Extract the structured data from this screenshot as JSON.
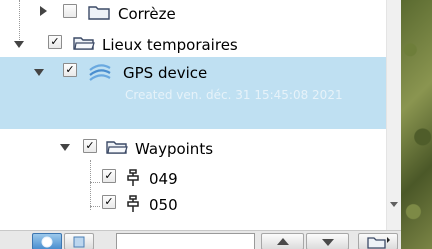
{
  "tree": {
    "items": [
      {
        "label": "Corrèze",
        "checked": false,
        "expanded": false,
        "icon": "folder-icon"
      },
      {
        "label": "Lieux temporaires",
        "checked": true,
        "expanded": true,
        "icon": "folder-open-icon"
      },
      {
        "label": "GPS device",
        "checked": true,
        "expanded": true,
        "icon": "gps-device-icon",
        "selected": true,
        "subtext": "Created ven. déc. 31 15:45:08 2021"
      },
      {
        "label": "Waypoints",
        "checked": true,
        "expanded": true,
        "icon": "folder-open-icon"
      },
      {
        "label": "049",
        "checked": true,
        "icon": "waypoint-pin-icon"
      },
      {
        "label": "050",
        "checked": true,
        "icon": "waypoint-pin-icon"
      }
    ]
  },
  "checkmark": "✓",
  "toolbar": {
    "search_value": "",
    "buttons": [
      "places-view-icon",
      "layers-view-icon",
      "move-up-icon",
      "move-down-icon",
      "add-folder-icon"
    ]
  },
  "colors": {
    "selection": "#bfe0f2",
    "accent": "#4a8ecf"
  }
}
